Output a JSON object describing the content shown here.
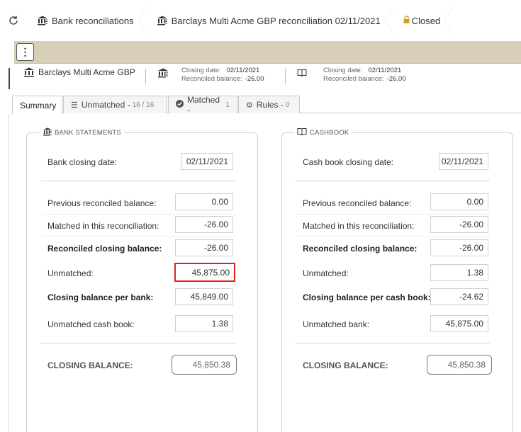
{
  "breadcrumb": {
    "items": [
      {
        "label": "Bank reconciliations"
      },
      {
        "label": "Barclays Multi Acme GBP reconciliation 02/11/2021"
      },
      {
        "label": "Closed"
      }
    ]
  },
  "toolbar": {
    "menu_label": "⋮"
  },
  "account": {
    "name": "Barclays Multi Acme GBP",
    "bank_info": {
      "closing_date_label": "Closing date:",
      "closing_date": "02/11/2021",
      "reconciled_label": "Reconciled balance:",
      "reconciled": "-26.00"
    },
    "cash_info": {
      "closing_date_label": "Closing date:",
      "closing_date": "02/11/2021",
      "reconciled_label": "Reconciled balance:",
      "reconciled": "-26.00"
    }
  },
  "tabs": [
    {
      "label": "Summary",
      "count": ""
    },
    {
      "label": "Unmatched -",
      "count": "16 / 16"
    },
    {
      "label": "Matched -",
      "count": "1"
    },
    {
      "label": "Rules -",
      "count": "0"
    }
  ],
  "bank": {
    "legend": "BANK STATEMENTS",
    "closing_date_label": "Bank closing date:",
    "closing_date": "02/11/2021",
    "rows": [
      {
        "label": "Previous reconciled balance:",
        "value": "0.00"
      },
      {
        "label": "Matched in this reconciliation:",
        "value": "-26.00"
      },
      {
        "label": "Reconciled closing balance:",
        "value": "-26.00"
      },
      {
        "label": "Unmatched:",
        "value": "45,875.00"
      },
      {
        "label": "Closing balance per bank:",
        "value": "45,849.00"
      },
      {
        "label": "Unmatched cash book:",
        "value": "1.38"
      }
    ],
    "total_label": "CLOSING BALANCE:",
    "total": "45,850.38"
  },
  "cash": {
    "legend": "CASHBOOK",
    "closing_date_label": "Cash book closing date:",
    "closing_date": "02/11/2021",
    "rows": [
      {
        "label": "Previous reconciled balance:",
        "value": "0.00"
      },
      {
        "label": "Matched in this reconciliation:",
        "value": "-26.00"
      },
      {
        "label": "Reconciled closing balance:",
        "value": "-26.00"
      },
      {
        "label": "Unmatched:",
        "value": "1.38"
      },
      {
        "label": "Closing balance per cash book:",
        "value": "-24.62"
      },
      {
        "label": "Unmatched bank:",
        "value": "45,875.00"
      }
    ],
    "total_label": "CLOSING BALANCE:",
    "total": "45,850.38"
  },
  "colors": {
    "toolbar": "#d7cfb7",
    "highlight": "#e02020",
    "lock": "#d4a017",
    "total_border": "#6b7b8c"
  }
}
